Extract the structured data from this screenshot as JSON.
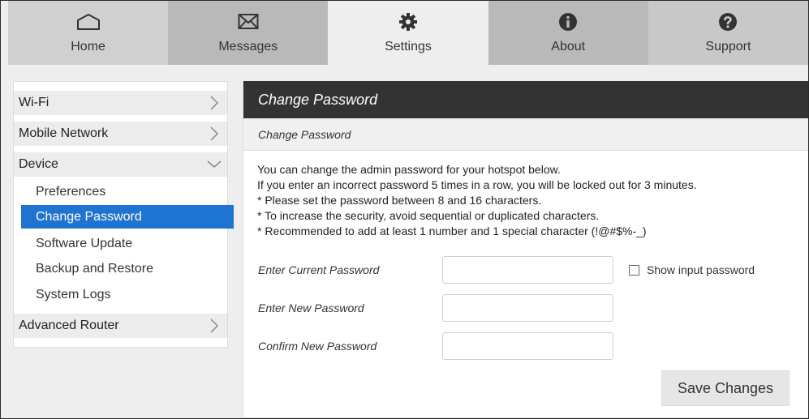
{
  "nav": {
    "tabs": [
      {
        "label": "Home",
        "icon": "home-icon"
      },
      {
        "label": "Messages",
        "icon": "envelope-icon"
      },
      {
        "label": "Settings",
        "icon": "gear-icon",
        "active": true
      },
      {
        "label": "About",
        "icon": "info-icon"
      },
      {
        "label": "Support",
        "icon": "question-icon"
      }
    ]
  },
  "sidebar": {
    "groups": [
      {
        "label": "Wi-Fi"
      },
      {
        "label": "Mobile Network"
      },
      {
        "label": "Device",
        "expanded": true
      },
      {
        "label": "Advanced Router"
      }
    ],
    "device_items": [
      {
        "label": "Preferences"
      },
      {
        "label": "Change Password",
        "active": true
      },
      {
        "label": "Software Update"
      },
      {
        "label": "Backup and Restore"
      },
      {
        "label": "System Logs"
      }
    ]
  },
  "main": {
    "title": "Change Password",
    "subtitle": "Change Password",
    "description": [
      "You can change the admin password for your hotspot below.",
      "If you enter an incorrect password 5 times in a row, you will be locked out for 3 minutes.",
      "* Please set the password between 8 and 16 characters.",
      "* To increase the security, avoid sequential or duplicated characters.",
      "* Recommended to add at least 1 number and 1 special character (!@#$%-_)"
    ],
    "fields": {
      "current_label": "Enter Current Password",
      "current_value": "",
      "new_label": "Enter New Password",
      "new_value": "",
      "confirm_label": "Confirm New Password",
      "confirm_value": ""
    },
    "show_password_label": "Show input password",
    "show_password_checked": false,
    "save_label": "Save Changes"
  },
  "colors": {
    "accent": "#1f74d1",
    "header": "#333333"
  }
}
